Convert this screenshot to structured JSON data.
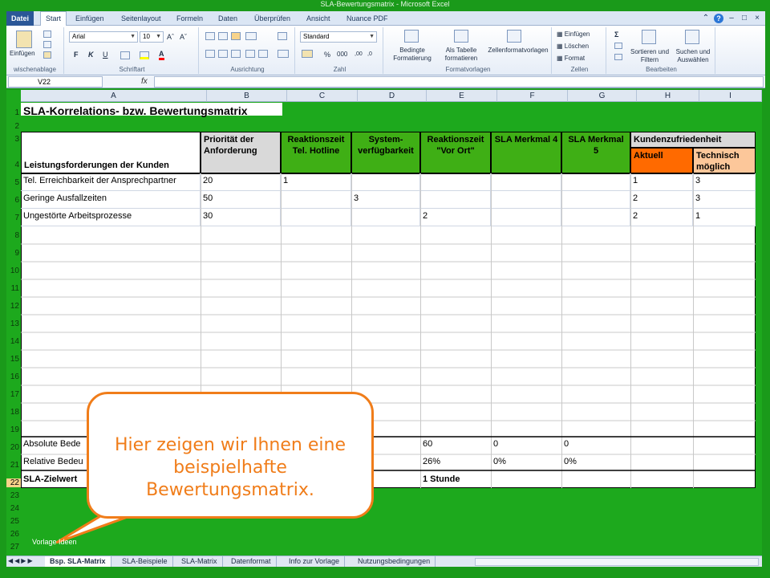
{
  "window": {
    "title": "SLA-Bewertungsmatrix - Microsoft Excel"
  },
  "ribbon_tabs": [
    "Datei",
    "Start",
    "Einfügen",
    "Seitenlayout",
    "Formeln",
    "Daten",
    "Überprüfen",
    "Ansicht",
    "Nuance PDF"
  ],
  "ribbon": {
    "clipboard": {
      "label": "wischenablage",
      "paste": "Einfügen"
    },
    "font": {
      "label": "Schriftart",
      "name": "Arial",
      "size": "10",
      "bold": "F",
      "italic": "K",
      "underline": "U"
    },
    "alignment": {
      "label": "Ausrichtung"
    },
    "number": {
      "label": "Zahl",
      "format": "Standard",
      "percent": "%",
      "thousands": "000",
      "dec_inc": ",00",
      "dec_dec": ",0"
    },
    "styles": {
      "label": "Formatvorlagen",
      "conditional": "Bedingte Formatierung",
      "as_table": "Als Tabelle formatieren",
      "cell_styles": "Zellenformatvorlagen"
    },
    "cells": {
      "label": "Zellen",
      "insert": "Einfügen",
      "delete": "Löschen",
      "format": "Format"
    },
    "editing": {
      "label": "Bearbeiten",
      "sort": "Sortieren und Filtern",
      "find": "Suchen und Auswählen"
    }
  },
  "formula_bar": {
    "name_box": "V22",
    "fx": "fx",
    "value": ""
  },
  "columns": [
    "A",
    "B",
    "C",
    "D",
    "E",
    "F",
    "G",
    "H",
    "I"
  ],
  "rows": [
    "1",
    "2",
    "3",
    "4",
    "5",
    "6",
    "7",
    "8",
    "9",
    "10",
    "11",
    "12",
    "13",
    "14",
    "15",
    "16",
    "17",
    "18",
    "19",
    "20",
    "21",
    "22",
    "23",
    "24",
    "25",
    "26",
    "27"
  ],
  "sheet": {
    "title": "SLA-Korrelations- bzw. Bewertungsmatrix",
    "header": {
      "a": "Leistungsforderungen der Kunden",
      "b": "Priorität der Anforderung",
      "c": "Reaktionszeit Tel. Hotline",
      "d": "System-verfügbarkeit",
      "e": "Reaktionszeit \"Vor Ort\"",
      "f": "SLA Merkmal 4",
      "g": "SLA Merkmal 5",
      "h": "Kundenzufriedenheit",
      "h_sub": "Aktuell",
      "i_sub": "Technisch möglich"
    },
    "data_rows": [
      {
        "a": "Tel. Erreichbarkeit der Ansprechpartner",
        "b": "20",
        "c": "1",
        "d": "",
        "e": "",
        "f": "",
        "g": "",
        "h": "1",
        "i": "3"
      },
      {
        "a": "Geringe Ausfallzeiten",
        "b": "50",
        "c": "",
        "d": "3",
        "e": "",
        "f": "",
        "g": "",
        "h": "2",
        "i": "3"
      },
      {
        "a": "Ungestörte Arbeitsprozesse",
        "b": "30",
        "c": "",
        "d": "",
        "e": "2",
        "f": "",
        "g": "",
        "h": "2",
        "i": "1"
      }
    ],
    "summary": {
      "abs_label": "Absolute Bede",
      "rel_label": "Relative Bedeu",
      "target_label": "SLA-Zielwert",
      "abs_e": "60",
      "abs_f": "0",
      "abs_g": "0",
      "rel_e": "26%",
      "rel_f": "0%",
      "rel_g": "0%",
      "target_e": "1 Stunde"
    }
  },
  "bubble": {
    "line1": "Hier zeigen wir Ihnen eine",
    "line2": "beispielhafte Bewertungsmatrix."
  },
  "footnote": "Vorlage Ideen",
  "sheet_tabs": [
    "Bsp. SLA-Matrix",
    "SLA-Beispiele",
    "SLA-Matrix",
    "Datenformat",
    "Info zur Vorlage",
    "Nutzungsbedingungen"
  ],
  "colors": {
    "background": "#1a9a1a",
    "accent_green": "#3faf15",
    "accent_orange": "#ff6a00",
    "peach": "#fcc79a",
    "bubble": "#f07d1a"
  }
}
